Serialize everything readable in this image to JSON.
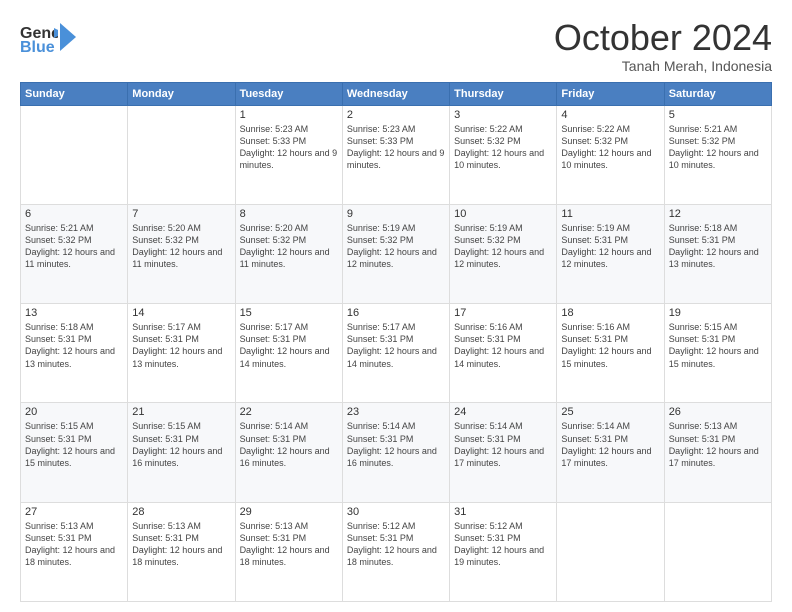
{
  "logo": {
    "line1": "General",
    "line2": "Blue",
    "icon": "▶"
  },
  "title": "October 2024",
  "subtitle": "Tanah Merah, Indonesia",
  "days_header": [
    "Sunday",
    "Monday",
    "Tuesday",
    "Wednesday",
    "Thursday",
    "Friday",
    "Saturday"
  ],
  "weeks": [
    [
      {
        "day": "",
        "info": ""
      },
      {
        "day": "",
        "info": ""
      },
      {
        "day": "1",
        "info": "Sunrise: 5:23 AM\nSunset: 5:33 PM\nDaylight: 12 hours and 9 minutes."
      },
      {
        "day": "2",
        "info": "Sunrise: 5:23 AM\nSunset: 5:33 PM\nDaylight: 12 hours and 9 minutes."
      },
      {
        "day": "3",
        "info": "Sunrise: 5:22 AM\nSunset: 5:32 PM\nDaylight: 12 hours and 10 minutes."
      },
      {
        "day": "4",
        "info": "Sunrise: 5:22 AM\nSunset: 5:32 PM\nDaylight: 12 hours and 10 minutes."
      },
      {
        "day": "5",
        "info": "Sunrise: 5:21 AM\nSunset: 5:32 PM\nDaylight: 12 hours and 10 minutes."
      }
    ],
    [
      {
        "day": "6",
        "info": "Sunrise: 5:21 AM\nSunset: 5:32 PM\nDaylight: 12 hours and 11 minutes."
      },
      {
        "day": "7",
        "info": "Sunrise: 5:20 AM\nSunset: 5:32 PM\nDaylight: 12 hours and 11 minutes."
      },
      {
        "day": "8",
        "info": "Sunrise: 5:20 AM\nSunset: 5:32 PM\nDaylight: 12 hours and 11 minutes."
      },
      {
        "day": "9",
        "info": "Sunrise: 5:19 AM\nSunset: 5:32 PM\nDaylight: 12 hours and 12 minutes."
      },
      {
        "day": "10",
        "info": "Sunrise: 5:19 AM\nSunset: 5:32 PM\nDaylight: 12 hours and 12 minutes."
      },
      {
        "day": "11",
        "info": "Sunrise: 5:19 AM\nSunset: 5:31 PM\nDaylight: 12 hours and 12 minutes."
      },
      {
        "day": "12",
        "info": "Sunrise: 5:18 AM\nSunset: 5:31 PM\nDaylight: 12 hours and 13 minutes."
      }
    ],
    [
      {
        "day": "13",
        "info": "Sunrise: 5:18 AM\nSunset: 5:31 PM\nDaylight: 12 hours and 13 minutes."
      },
      {
        "day": "14",
        "info": "Sunrise: 5:17 AM\nSunset: 5:31 PM\nDaylight: 12 hours and 13 minutes."
      },
      {
        "day": "15",
        "info": "Sunrise: 5:17 AM\nSunset: 5:31 PM\nDaylight: 12 hours and 14 minutes."
      },
      {
        "day": "16",
        "info": "Sunrise: 5:17 AM\nSunset: 5:31 PM\nDaylight: 12 hours and 14 minutes."
      },
      {
        "day": "17",
        "info": "Sunrise: 5:16 AM\nSunset: 5:31 PM\nDaylight: 12 hours and 14 minutes."
      },
      {
        "day": "18",
        "info": "Sunrise: 5:16 AM\nSunset: 5:31 PM\nDaylight: 12 hours and 15 minutes."
      },
      {
        "day": "19",
        "info": "Sunrise: 5:15 AM\nSunset: 5:31 PM\nDaylight: 12 hours and 15 minutes."
      }
    ],
    [
      {
        "day": "20",
        "info": "Sunrise: 5:15 AM\nSunset: 5:31 PM\nDaylight: 12 hours and 15 minutes."
      },
      {
        "day": "21",
        "info": "Sunrise: 5:15 AM\nSunset: 5:31 PM\nDaylight: 12 hours and 16 minutes."
      },
      {
        "day": "22",
        "info": "Sunrise: 5:14 AM\nSunset: 5:31 PM\nDaylight: 12 hours and 16 minutes."
      },
      {
        "day": "23",
        "info": "Sunrise: 5:14 AM\nSunset: 5:31 PM\nDaylight: 12 hours and 16 minutes."
      },
      {
        "day": "24",
        "info": "Sunrise: 5:14 AM\nSunset: 5:31 PM\nDaylight: 12 hours and 17 minutes."
      },
      {
        "day": "25",
        "info": "Sunrise: 5:14 AM\nSunset: 5:31 PM\nDaylight: 12 hours and 17 minutes."
      },
      {
        "day": "26",
        "info": "Sunrise: 5:13 AM\nSunset: 5:31 PM\nDaylight: 12 hours and 17 minutes."
      }
    ],
    [
      {
        "day": "27",
        "info": "Sunrise: 5:13 AM\nSunset: 5:31 PM\nDaylight: 12 hours and 18 minutes."
      },
      {
        "day": "28",
        "info": "Sunrise: 5:13 AM\nSunset: 5:31 PM\nDaylight: 12 hours and 18 minutes."
      },
      {
        "day": "29",
        "info": "Sunrise: 5:13 AM\nSunset: 5:31 PM\nDaylight: 12 hours and 18 minutes."
      },
      {
        "day": "30",
        "info": "Sunrise: 5:12 AM\nSunset: 5:31 PM\nDaylight: 12 hours and 18 minutes."
      },
      {
        "day": "31",
        "info": "Sunrise: 5:12 AM\nSunset: 5:31 PM\nDaylight: 12 hours and 19 minutes."
      },
      {
        "day": "",
        "info": ""
      },
      {
        "day": "",
        "info": ""
      }
    ]
  ],
  "row_classes": [
    "row-odd",
    "row-even",
    "row-odd",
    "row-even",
    "row-odd"
  ]
}
